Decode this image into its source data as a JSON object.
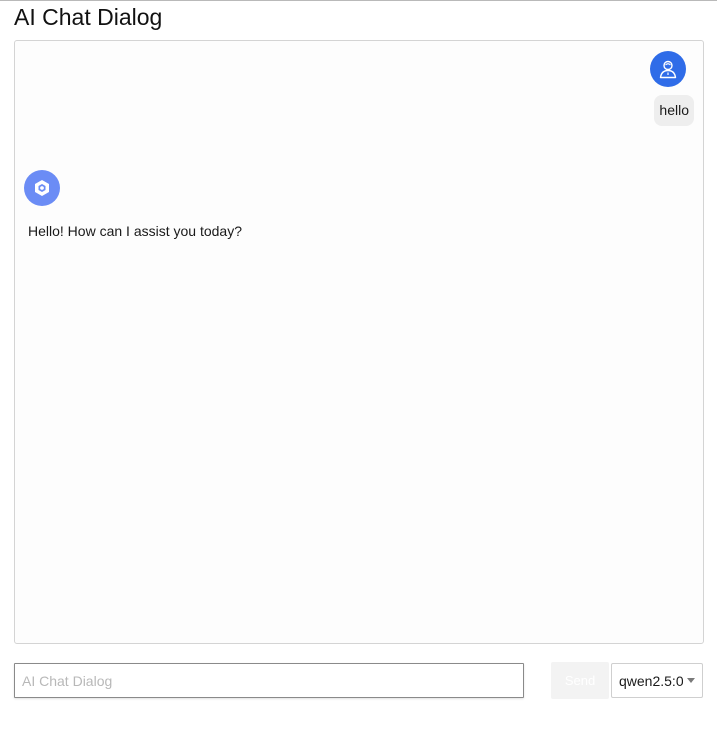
{
  "page": {
    "title": "AI Chat Dialog"
  },
  "messages": [
    {
      "role": "user",
      "text": "hello",
      "avatar_icon": "user-icon"
    },
    {
      "role": "assistant",
      "text": "Hello! How can I assist you today?",
      "avatar_icon": "hexagon-bot-icon"
    }
  ],
  "composer": {
    "input_value": "",
    "input_placeholder": "AI Chat Dialog",
    "send_label": "Send",
    "model_selected": "qwen2.5:0"
  },
  "colors": {
    "user_avatar": "#2f6ce8",
    "bot_avatar": "#6b8cf5",
    "user_bubble": "#eeeeee"
  }
}
